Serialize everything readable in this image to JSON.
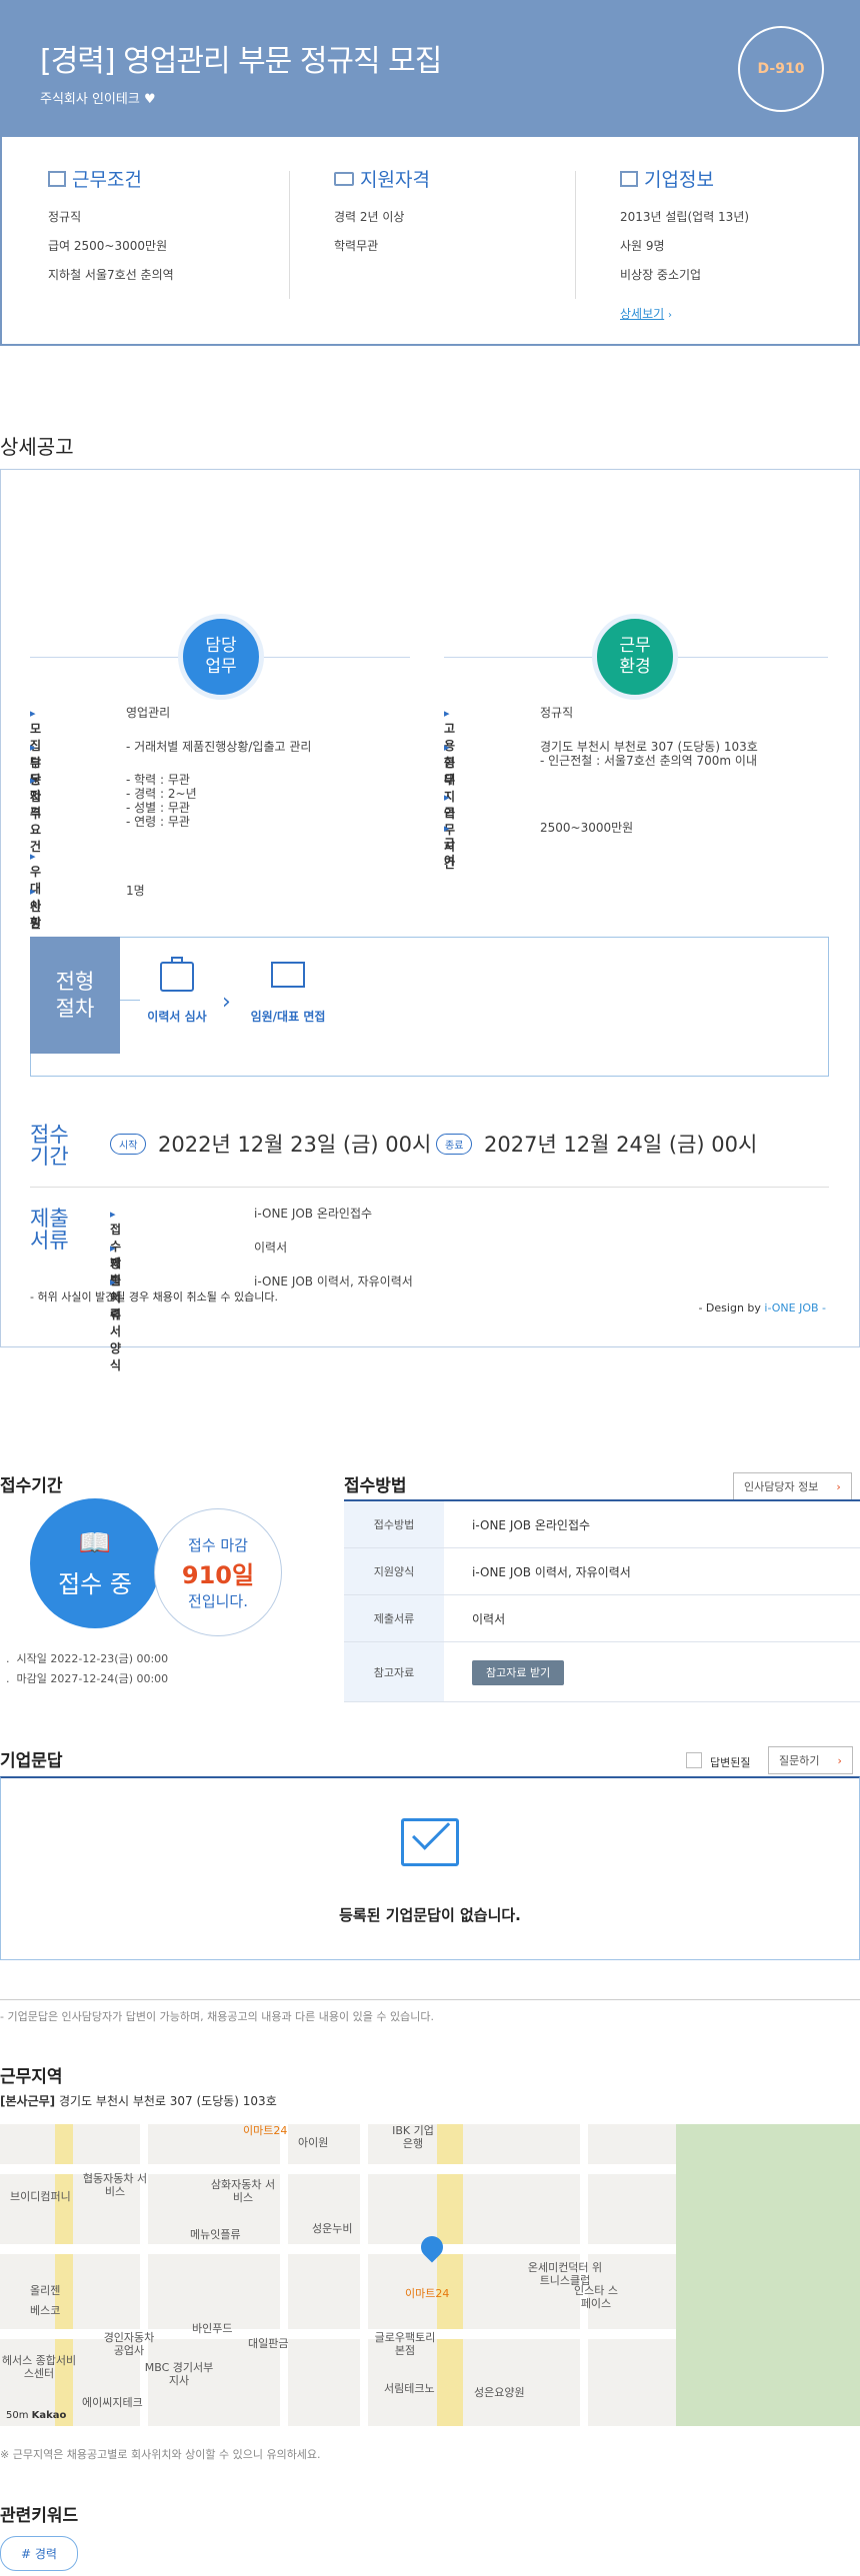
{
  "header": {
    "title": "[경력] 영업관리 부문 정규직 모집",
    "company": "주식회사 인이테크",
    "dday": "D-910"
  },
  "summary": {
    "work": {
      "title": "근무조건",
      "items": [
        "정규직",
        "급여 2500~3000만원",
        "지하철 서울7호선 춘의역"
      ]
    },
    "qual": {
      "title": "지원자격",
      "items": [
        "경력 2년 이상",
        "학력무관"
      ]
    },
    "company": {
      "title": "기업정보",
      "items": [
        "2013년 설립(업력 13년)",
        "사원 9명",
        "비상장 중소기업"
      ],
      "more": "상세보기"
    }
  },
  "detail": {
    "title": "상세공고",
    "job_section": "담당\n업무",
    "env_section": "근무\n환경",
    "job_rows": [
      {
        "label": "모집부문",
        "value": "영업관리"
      },
      {
        "label": "담당업무",
        "value": "- 거래처별 제품진행상황/입출고 관리"
      },
      {
        "label": "자격요건",
        "value": "- 학력 : 무관\n- 경력 : 2~년\n- 성별 : 무관\n- 연령 : 무관"
      },
      {
        "label": "우대사항",
        "value": ""
      },
      {
        "label": "인원",
        "value": "1명"
      }
    ],
    "env_rows": [
      {
        "label": "고용형태",
        "value": "정규직"
      },
      {
        "label": "근무지역",
        "value": "경기도 부천시 부천로 307 (도당동) 103호\n- 인근전철 : 서울7호선 춘의역 700m 이내"
      },
      {
        "label": "근무시간",
        "value": ""
      },
      {
        "label": "급여",
        "value": "2500~3000만원"
      }
    ],
    "process_label": "전형\n절차",
    "process_steps": [
      "이력서 심사",
      "임원/대표 면접"
    ],
    "period_label": "접수\n기간",
    "start_badge": "시작",
    "start_date": "2022년 12월 23일 (금) 00시",
    "end_badge": "종료",
    "end_date": "2027년 12월 24일 (금) 00시",
    "docs_label": "제출\n서류",
    "docs_rows": [
      {
        "label": "접수방법",
        "value": "i-ONE JOB 온라인접수"
      },
      {
        "label": "제출서류",
        "value": "이력서"
      },
      {
        "label": "이력서양식",
        "value": "i-ONE JOB 이력서, 자유이력서"
      }
    ],
    "notice": "- 허위 사실이 발견될 경우 채용이 취소될 수 있습니다.",
    "design_prefix": "- Design by ",
    "design_brand": "i-ONE JOB -"
  },
  "apply_period": {
    "title": "접수기간",
    "status": "접수 중",
    "deadline_label": "접수 마감",
    "days_left": "910일",
    "suffix": "전입니다.",
    "start": "시작일 2022-12-23(금) 00:00",
    "end": "마감일 2027-12-24(금) 00:00"
  },
  "apply_method": {
    "title": "접수방법",
    "hr_button": "인사담당자 정보",
    "rows": [
      {
        "key": "접수방법",
        "value": "i-ONE JOB 온라인접수"
      },
      {
        "key": "지원양식",
        "value": "i-ONE JOB 이력서, 자유이력서"
      },
      {
        "key": "제출서류",
        "value": "이력서"
      },
      {
        "key": "참고자료",
        "value": "참고자료 받기"
      }
    ]
  },
  "qa": {
    "title": "기업문답",
    "answered_label": "답변된질",
    "ask_button": "질문하기",
    "empty": "등록된 기업문답이 없습니다.",
    "note": "- 기업문답은 인사담당자가 답변이 가능하며, 채용공고의 내용과 다른 내용이 있을 수 있습니다."
  },
  "location": {
    "title": "근무지역",
    "branch_tag": "[본사근무]",
    "address": "경기도 부천시 부천로 307 (도당동) 103호",
    "note": "※ 근무지역은 채용공고별로 회사위치와 상이할 수 있으니 유의하세요.",
    "map_labels": [
      "이마트24",
      "아이원",
      "IBK 기업은행",
      "협동자동차 서비스",
      "삼화자동차 서비스",
      "브이디컴퍼니",
      "메뉴잇플류",
      "성운누비",
      "이마트24",
      "온세미컨덕터 위트니스클럽",
      "인스타 스페이스",
      "올리젠",
      "베스코",
      "경인자동차 공업사",
      "바인푸드",
      "대일판금",
      "글로우팩토리 본점",
      "헤서스 종합서비스센터",
      "MBC 경기서부지사",
      "서림테크노",
      "성은요양원",
      "에이씨지테크"
    ],
    "scale": "50m",
    "brand": "Kakao"
  },
  "keywords": {
    "title": "관련키워드",
    "items": [
      "# 경력"
    ]
  }
}
